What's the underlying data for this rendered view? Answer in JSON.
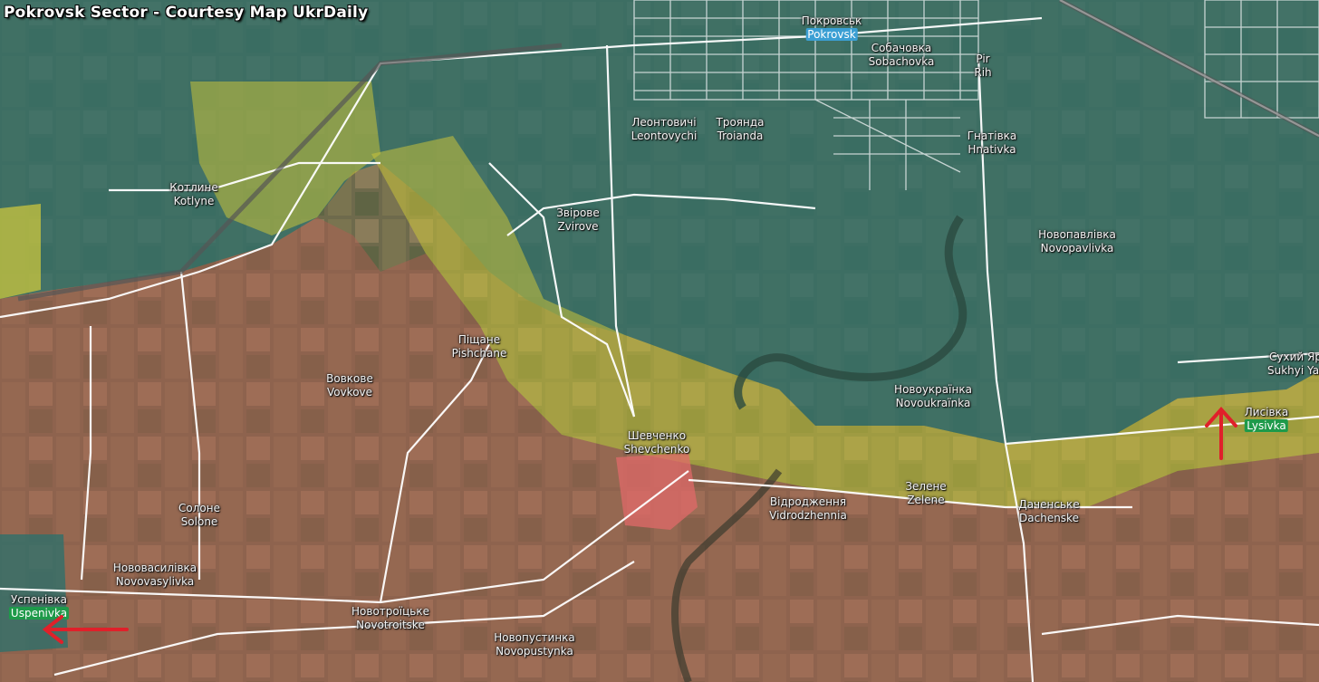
{
  "title": "Pokrovsk Sector - Courtesy Map UkrDaily",
  "colors": {
    "ukraine_control": "#2f6f6a",
    "contested": "#c8c23a",
    "russia_control": "#c45a5a",
    "road": "#ffffff",
    "arrow": "#e0202a"
  },
  "places": [
    {
      "id": "pokrovsk",
      "native": "Покровськ",
      "latin": "Pokrovsk",
      "highlight": "blue"
    },
    {
      "id": "sobachovka",
      "native": "Собачовка",
      "latin": "Sobachovka"
    },
    {
      "id": "pir-rih",
      "native": "Pir",
      "latin": "Rih"
    },
    {
      "id": "leontovychi",
      "native": "Леонтовичі",
      "latin": "Leontovychi"
    },
    {
      "id": "troianda",
      "native": "Троянда",
      "latin": "Troianda"
    },
    {
      "id": "hnativka",
      "native": "Гнатівка",
      "latin": "Hnativka"
    },
    {
      "id": "kotlyne",
      "native": "Котлине",
      "latin": "Kotlyne"
    },
    {
      "id": "zvirove",
      "native": "Звірове",
      "latin": "Zvirove"
    },
    {
      "id": "novopavlivka",
      "native": "Новопавлівка",
      "latin": "Novopavlivka"
    },
    {
      "id": "pishchane",
      "native": "Піщане",
      "latin": "Pishchane"
    },
    {
      "id": "vovkove",
      "native": "Вовкове",
      "latin": "Vovkove"
    },
    {
      "id": "sukhyi-yar",
      "native": "Сухий Яр",
      "latin": "Sukhyi Yar"
    },
    {
      "id": "novoukrainka",
      "native": "Новоукраїнка",
      "latin": "Novoukraïnka"
    },
    {
      "id": "lysivka",
      "native": "Лисівка",
      "latin": "Lysivka",
      "highlight": "green"
    },
    {
      "id": "shevchenko",
      "native": "Шевченко",
      "latin": "Shevchenko"
    },
    {
      "id": "zelene",
      "native": "Зелене",
      "latin": "Zelene"
    },
    {
      "id": "solone",
      "native": "Солоне",
      "latin": "Solone"
    },
    {
      "id": "vidrodzhennia",
      "native": "Відродження",
      "latin": "Vidrodzhennia"
    },
    {
      "id": "dachenske",
      "native": "Даченське",
      "latin": "Dachenske"
    },
    {
      "id": "novovasylivka",
      "native": "Нововасилівка",
      "latin": "Novovasylivka"
    },
    {
      "id": "uspenivka",
      "native": "Успенівка",
      "latin": "Uspenivka",
      "highlight": "green"
    },
    {
      "id": "novotroitske",
      "native": "Новотроїцьке",
      "latin": "Novotroitske"
    },
    {
      "id": "novopustynka",
      "native": "Новопустинка",
      "latin": "Novopustynka"
    }
  ],
  "arrows": [
    {
      "id": "arrow-lysivka",
      "direction": "up"
    },
    {
      "id": "arrow-uspenivka",
      "direction": "left"
    }
  ]
}
